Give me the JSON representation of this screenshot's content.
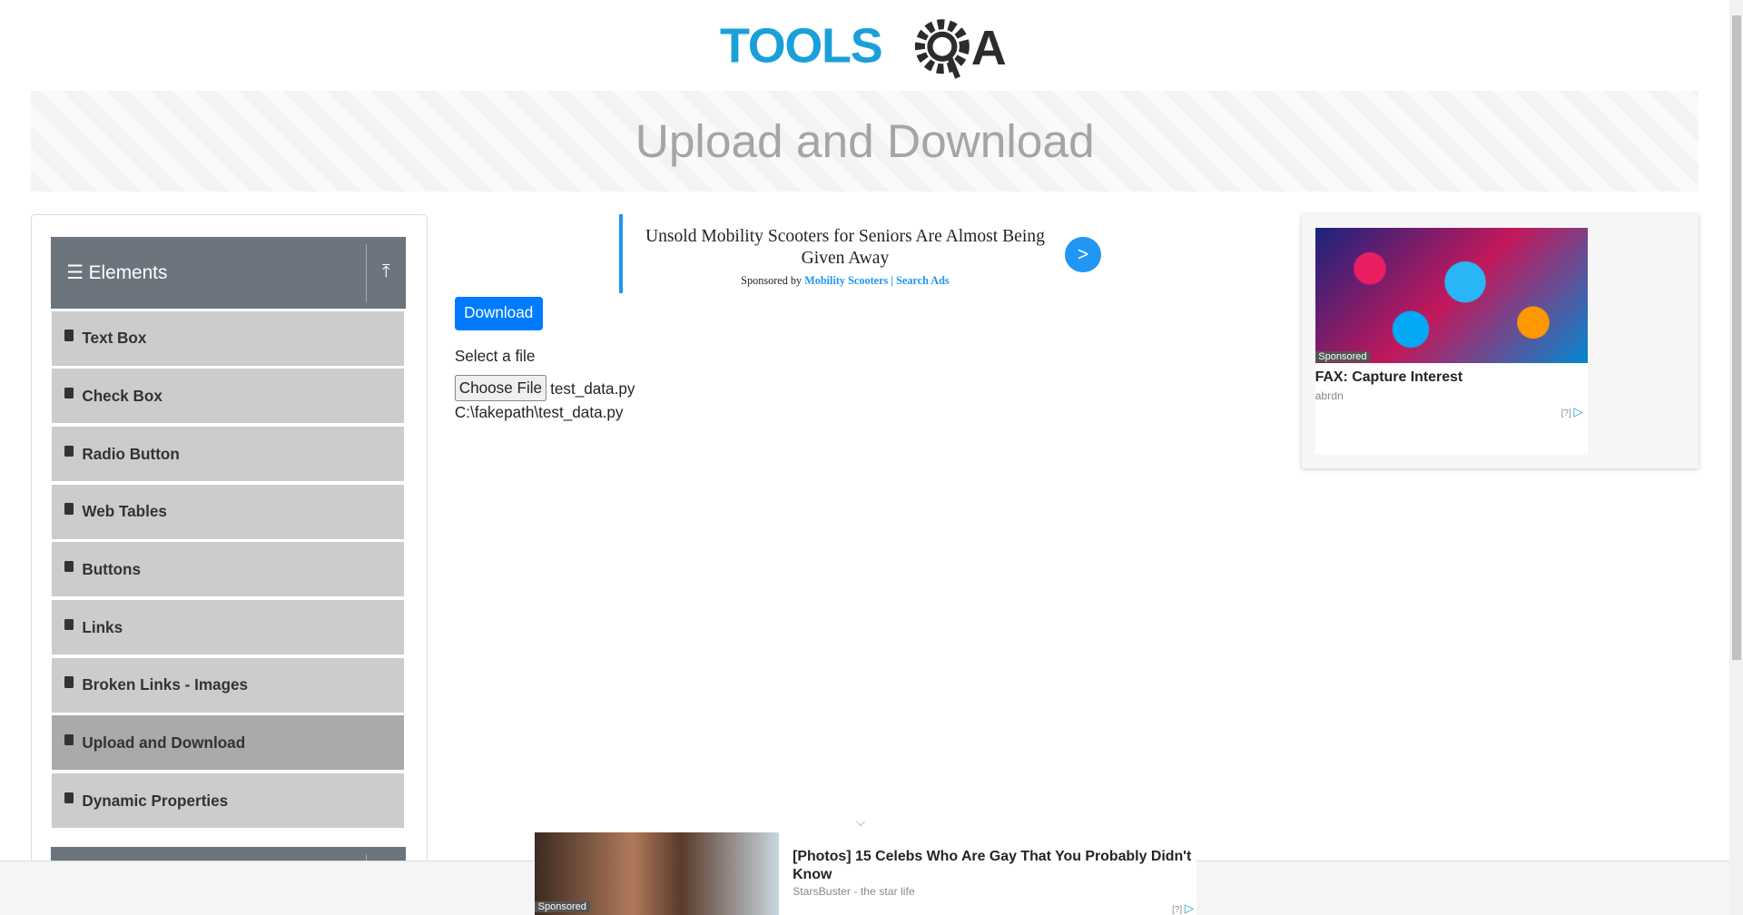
{
  "header": {
    "logo_text": "TOOLSQA",
    "page_title": "Upload and Download"
  },
  "sidebar": {
    "group": "Elements",
    "items": [
      {
        "label": "Text Box"
      },
      {
        "label": "Check Box"
      },
      {
        "label": "Radio Button"
      },
      {
        "label": "Web Tables"
      },
      {
        "label": "Buttons"
      },
      {
        "label": "Links"
      },
      {
        "label": "Broken Links - Images"
      },
      {
        "label": "Upload and Download",
        "active": true
      },
      {
        "label": "Dynamic Properties"
      }
    ]
  },
  "top_ad": {
    "headline": "Unsold Mobility Scooters for Seniors Are Almost Being Given Away",
    "sponsored_by": "Sponsored by",
    "sponsor": "Mobility Scooters | Search Ads",
    "arrow": ">"
  },
  "main": {
    "download_label": "Download",
    "select_label": "Select a file",
    "choose_file": "Choose File",
    "file_name": "test_data.py",
    "uploaded_path": "C:\\fakepath\\test_data.py"
  },
  "right_ad": {
    "badge": "Sponsored",
    "title": "FAX: Capture Interest",
    "source": "abrdn",
    "help": "[?]"
  },
  "bottom_ad": {
    "badge": "Sponsored",
    "title": "[Photos] 15 Celebs Who Are Gay That You Probably Didn't Know",
    "source": "StarsBuster - the star life",
    "help": "[?]"
  },
  "colors": {
    "accent": "#007bff",
    "group_header": "#6c757d",
    "ad_blue": "#2196f3"
  }
}
